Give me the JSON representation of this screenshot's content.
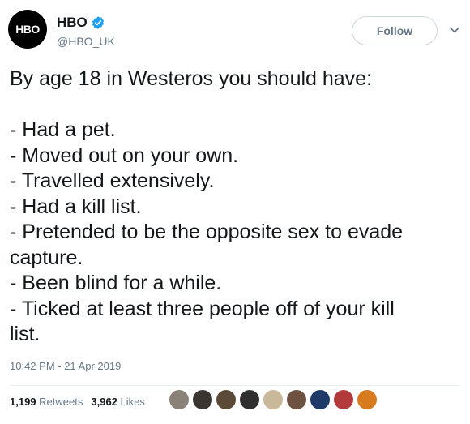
{
  "user": {
    "avatar_text": "HBO",
    "display_name": "HBO",
    "handle": "@HBO_UK"
  },
  "follow_label": "Follow",
  "tweet_text": "By age 18 in Westeros you should have:\n\n- Had a pet.\n- Moved out on your own.\n- Travelled extensively.\n- Had a kill list.\n- Pretended to be the opposite sex to evade\ncapture.\n- Been blind for a while.\n- Ticked at least three people off of your kill\nlist.",
  "timestamp": "10:42 PM - 21 Apr 2019",
  "stats": {
    "retweets_count": "1,199",
    "retweets_label": "Retweets",
    "likes_count": "3,962",
    "likes_label": "Likes"
  },
  "liker_avatars": [
    {
      "name": "liker-avatar-1",
      "color": "#8a8278"
    },
    {
      "name": "liker-avatar-2",
      "color": "#3a3530"
    },
    {
      "name": "liker-avatar-3",
      "color": "#5b4a38"
    },
    {
      "name": "liker-avatar-4",
      "color": "#2f2f2f"
    },
    {
      "name": "liker-avatar-5",
      "color": "#c9b99a"
    },
    {
      "name": "liker-avatar-6",
      "color": "#6d5242"
    },
    {
      "name": "liker-avatar-7",
      "color": "#1f3a68"
    },
    {
      "name": "liker-avatar-8",
      "color": "#b23a3a"
    },
    {
      "name": "liker-avatar-9",
      "color": "#d87a1e"
    }
  ],
  "colors": {
    "text": "#14171a",
    "muted": "#657786",
    "verified": "#1da1f2",
    "border": "#ccd6dd"
  }
}
